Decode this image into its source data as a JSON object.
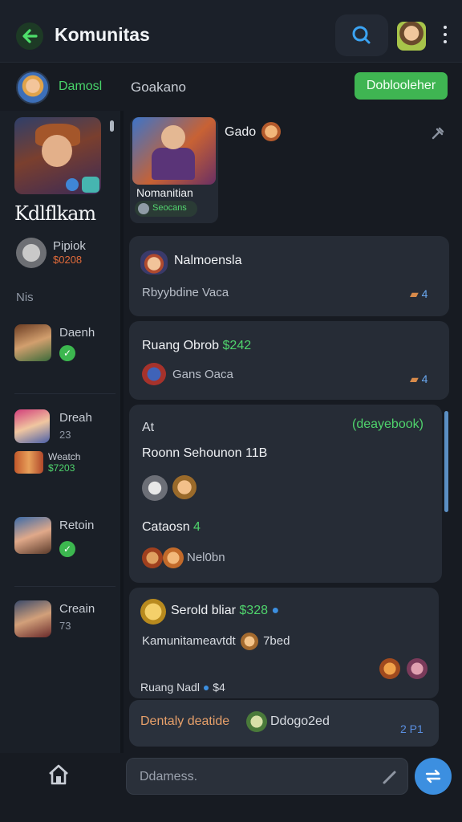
{
  "header": {
    "title": "Komunitas"
  },
  "subbar": {
    "user_name": "Damosl",
    "label": "Goakano",
    "action_label": "Doblooleher"
  },
  "sidebar": {
    "hero_name": "Kdlflkam",
    "section_label": "Nis",
    "items": [
      {
        "name": "Pipiok",
        "sub": "$0208"
      },
      {
        "name": "Daenh",
        "sub": ""
      },
      {
        "name": "Dreah",
        "sub": "23"
      },
      {
        "name": "Weatch",
        "sub": "$7203"
      },
      {
        "name": "Retoin",
        "sub": ""
      },
      {
        "name": "Creain",
        "sub": "73"
      }
    ]
  },
  "featured": {
    "title": "Nomanitian",
    "pill": "Seocans",
    "name": "Gado"
  },
  "cards": [
    {
      "title": "Nalmoensla",
      "sub": "Rbyybdine Vaca",
      "count": "4"
    },
    {
      "title": "Ruang Obrob",
      "title_value": "$242",
      "sub": "Gans Oaca",
      "count": "4"
    },
    {
      "head_left": "At",
      "head_right": "(deayebook)",
      "line1": "Roonn Sehounon 11B",
      "line2": "Cataosn",
      "line2_value": "4",
      "line3": "Nel0bn"
    },
    {
      "title": "Serold bliar",
      "title_value": "$328",
      "line1": "Kamunitameavtdt",
      "line1_tail": "7bed",
      "line2": "Ruang Nadl",
      "line2_value": "$4"
    },
    {
      "title": "Dentaly deatide",
      "tail": "Ddogo2ed",
      "count": "2 P1"
    }
  ],
  "composer": {
    "placeholder": "Ddamess."
  },
  "colors": {
    "accent_green": "#3fb552",
    "accent_blue": "#3c8fe0",
    "background": "#171b22",
    "card": "#262c36"
  },
  "icons": [
    "back-arrow-icon",
    "search-icon",
    "more-vertical-icon",
    "pin-icon",
    "home-icon",
    "pen-icon",
    "send-icon"
  ]
}
